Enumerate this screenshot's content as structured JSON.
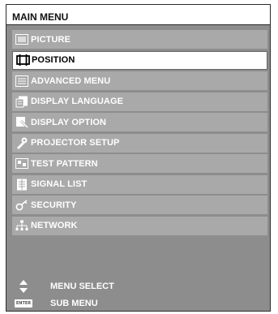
{
  "menu": {
    "title": "MAIN MENU",
    "items": [
      {
        "label": "PICTURE",
        "icon": "picture-icon"
      },
      {
        "label": "POSITION",
        "icon": "position-icon",
        "selected": true
      },
      {
        "label": "ADVANCED MENU",
        "icon": "advanced-menu-icon"
      },
      {
        "label": "DISPLAY LANGUAGE",
        "icon": "display-language-icon"
      },
      {
        "label": "DISPLAY OPTION",
        "icon": "display-option-icon"
      },
      {
        "label": "PROJECTOR SETUP",
        "icon": "projector-setup-icon"
      },
      {
        "label": "TEST PATTERN",
        "icon": "test-pattern-icon"
      },
      {
        "label": "SIGNAL LIST",
        "icon": "signal-list-icon"
      },
      {
        "label": "SECURITY",
        "icon": "security-key-icon"
      },
      {
        "label": "NETWORK",
        "icon": "network-icon"
      }
    ]
  },
  "footer": {
    "menu_select": "MENU SELECT",
    "sub_menu": "SUB MENU",
    "enter_key": "ENTER"
  },
  "colors": {
    "panel": "#8d8d8d",
    "item": "#a9a9a9",
    "selected": "#ffffff",
    "text": "#ffffff"
  }
}
